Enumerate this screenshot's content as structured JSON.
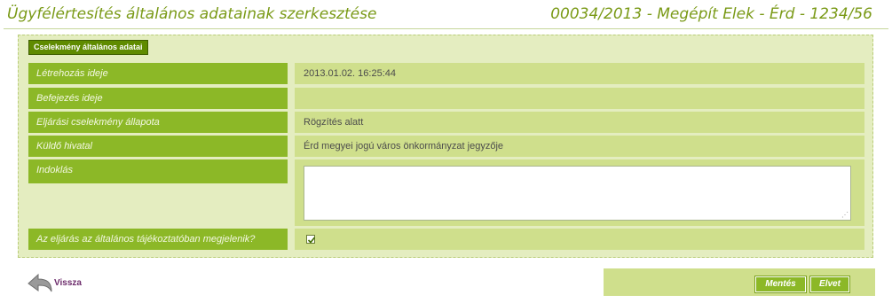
{
  "header": {
    "title": "Ügyfélértesítés általános adatainak szerkesztése",
    "case_info": "00034/2013 - Megépít Elek - Érd - 1234/56"
  },
  "fieldset": {
    "legend": "Cselekmény általános adatai"
  },
  "fields": [
    {
      "label": "Létrehozás ideje",
      "value": "2013.01.02. 16:25:44"
    },
    {
      "label": "Befejezés ideje",
      "value": ""
    },
    {
      "label": "Eljárási cselekmény állapota",
      "value": "Rögzítés alatt"
    },
    {
      "label": "Küldő hivatal",
      "value": "Érd megyei jogú város önkormányzat jegyzője"
    },
    {
      "label": "Indoklás",
      "value": ""
    },
    {
      "label": "Az eljárás az általános tájékoztatóban megjelenik?",
      "checked": true
    }
  ],
  "nav": {
    "back_label": "Vissza"
  },
  "actions": {
    "save_label": "Mentés",
    "discard_label": "Elvet"
  },
  "colors": {
    "accent_text": "#7a9a17",
    "label_bg": "#8cb827",
    "value_bg": "#cfdf8c",
    "panel_bg": "#e4edc0",
    "legend_bg": "#5f8b00",
    "back_link": "#6c2b6b"
  }
}
